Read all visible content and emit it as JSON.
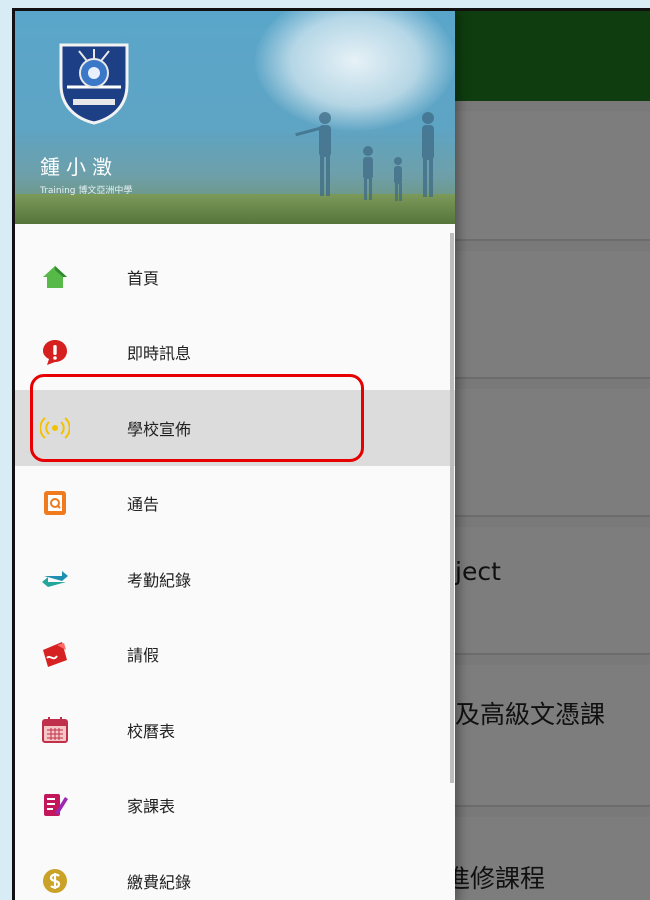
{
  "user": {
    "name": "鍾小澂",
    "subtitle": "Training 博文亞洲中學"
  },
  "menu": [
    {
      "label": "首頁",
      "icon": "home-icon"
    },
    {
      "label": "即時訊息",
      "icon": "alert-bubble-icon"
    },
    {
      "label": "學校宣佈",
      "icon": "broadcast-icon",
      "selected": true
    },
    {
      "label": "通告",
      "icon": "notice-icon"
    },
    {
      "label": "考勤紀錄",
      "icon": "swap-arrows-icon"
    },
    {
      "label": "請假",
      "icon": "leave-icon"
    },
    {
      "label": "校曆表",
      "icon": "calendar-icon"
    },
    {
      "label": "家課表",
      "icon": "homework-icon"
    },
    {
      "label": "繳費紀錄",
      "icon": "dollar-coin-icon"
    }
  ],
  "background_cards": [
    {
      "text": ""
    },
    {
      "text": ""
    },
    {
      "text": ""
    },
    {
      "text": "ject"
    },
    {
      "text": "及高級文憑課"
    },
    {
      "text": "進修課程"
    }
  ],
  "colors": {
    "toolbar": "#1f7a1f",
    "highlight": "#e60000",
    "selected_row": "#dcdcdc"
  }
}
